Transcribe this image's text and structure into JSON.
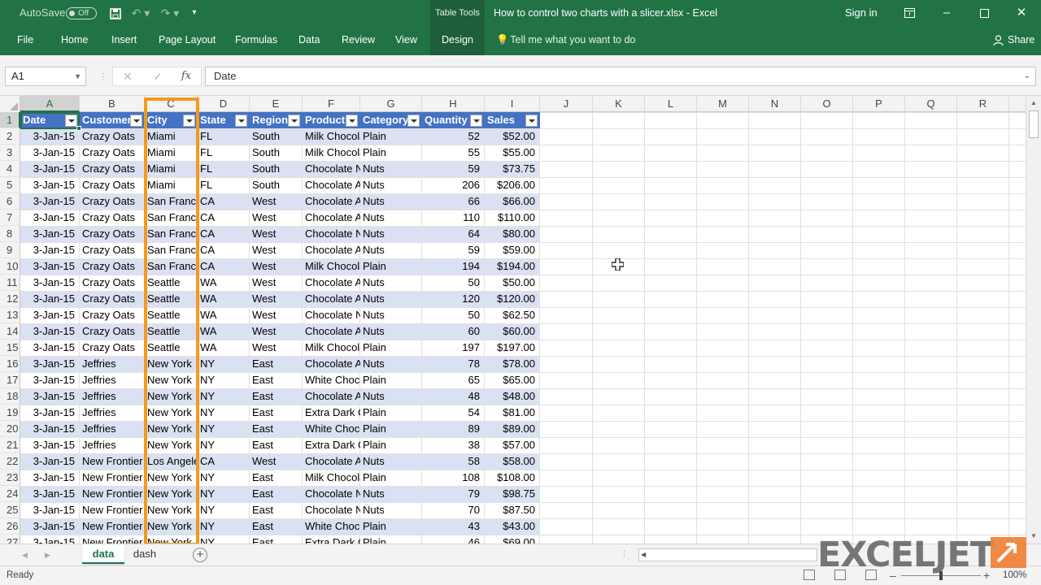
{
  "titlebar": {
    "autosave_label": "AutoSave",
    "autosave_state": "Off",
    "table_tools": "Table Tools",
    "title": "How to control two charts with a slicer.xlsx  -  Excel",
    "signin": "Sign in"
  },
  "ribbon": {
    "tabs": [
      "File",
      "Home",
      "Insert",
      "Page Layout",
      "Formulas",
      "Data",
      "Review",
      "View",
      "Design"
    ],
    "tell_me": "Tell me what you want to do",
    "share": "Share"
  },
  "formula_bar": {
    "name_box": "A1",
    "value": "Date"
  },
  "columns": [
    "A",
    "B",
    "C",
    "D",
    "E",
    "F",
    "G",
    "H",
    "I",
    "J",
    "K",
    "L",
    "M",
    "N",
    "O",
    "P",
    "Q",
    "R"
  ],
  "table": {
    "headers": [
      "Date",
      "Customer",
      "City",
      "State",
      "Region",
      "Product",
      "Category",
      "Quantity",
      "Sales"
    ],
    "rows": [
      [
        "3-Jan-15",
        "Crazy Oats",
        "Miami",
        "FL",
        "South",
        "Milk Chocolate",
        "Plain",
        "52",
        "$52.00"
      ],
      [
        "3-Jan-15",
        "Crazy Oats",
        "Miami",
        "FL",
        "South",
        "Milk Chocolate",
        "Plain",
        "55",
        "$55.00"
      ],
      [
        "3-Jan-15",
        "Crazy Oats",
        "Miami",
        "FL",
        "South",
        "Chocolate Nuts",
        "Nuts",
        "59",
        "$73.75"
      ],
      [
        "3-Jan-15",
        "Crazy Oats",
        "Miami",
        "FL",
        "South",
        "Chocolate Almonds",
        "Nuts",
        "206",
        "$206.00"
      ],
      [
        "3-Jan-15",
        "Crazy Oats",
        "San Francisco",
        "CA",
        "West",
        "Chocolate Almonds",
        "Nuts",
        "66",
        "$66.00"
      ],
      [
        "3-Jan-15",
        "Crazy Oats",
        "San Francisco",
        "CA",
        "West",
        "Chocolate Almonds",
        "Nuts",
        "110",
        "$110.00"
      ],
      [
        "3-Jan-15",
        "Crazy Oats",
        "San Francisco",
        "CA",
        "West",
        "Chocolate Nuts",
        "Nuts",
        "64",
        "$80.00"
      ],
      [
        "3-Jan-15",
        "Crazy Oats",
        "San Francisco",
        "CA",
        "West",
        "Chocolate Almonds",
        "Nuts",
        "59",
        "$59.00"
      ],
      [
        "3-Jan-15",
        "Crazy Oats",
        "San Francisco",
        "CA",
        "West",
        "Milk Chocolate",
        "Plain",
        "194",
        "$194.00"
      ],
      [
        "3-Jan-15",
        "Crazy Oats",
        "Seattle",
        "WA",
        "West",
        "Chocolate Almonds",
        "Nuts",
        "50",
        "$50.00"
      ],
      [
        "3-Jan-15",
        "Crazy Oats",
        "Seattle",
        "WA",
        "West",
        "Chocolate Almonds",
        "Nuts",
        "120",
        "$120.00"
      ],
      [
        "3-Jan-15",
        "Crazy Oats",
        "Seattle",
        "WA",
        "West",
        "Chocolate Nuts",
        "Nuts",
        "50",
        "$62.50"
      ],
      [
        "3-Jan-15",
        "Crazy Oats",
        "Seattle",
        "WA",
        "West",
        "Chocolate Almonds",
        "Nuts",
        "60",
        "$60.00"
      ],
      [
        "3-Jan-15",
        "Crazy Oats",
        "Seattle",
        "WA",
        "West",
        "Milk Chocolate",
        "Plain",
        "197",
        "$197.00"
      ],
      [
        "3-Jan-15",
        "Jeffries",
        "New York",
        "NY",
        "East",
        "Chocolate Almonds",
        "Nuts",
        "78",
        "$78.00"
      ],
      [
        "3-Jan-15",
        "Jeffries",
        "New York",
        "NY",
        "East",
        "White Chocolate",
        "Plain",
        "65",
        "$65.00"
      ],
      [
        "3-Jan-15",
        "Jeffries",
        "New York",
        "NY",
        "East",
        "Chocolate Almonds",
        "Nuts",
        "48",
        "$48.00"
      ],
      [
        "3-Jan-15",
        "Jeffries",
        "New York",
        "NY",
        "East",
        "Extra Dark Chocolate",
        "Plain",
        "54",
        "$81.00"
      ],
      [
        "3-Jan-15",
        "Jeffries",
        "New York",
        "NY",
        "East",
        "White Chocolate",
        "Plain",
        "89",
        "$89.00"
      ],
      [
        "3-Jan-15",
        "Jeffries",
        "New York",
        "NY",
        "East",
        "Extra Dark Chocolate",
        "Plain",
        "38",
        "$57.00"
      ],
      [
        "3-Jan-15",
        "New Frontier",
        "Los Angeles",
        "CA",
        "West",
        "Chocolate Almonds",
        "Nuts",
        "58",
        "$58.00"
      ],
      [
        "3-Jan-15",
        "New Frontier",
        "New York",
        "NY",
        "East",
        "Milk Chocolate",
        "Plain",
        "108",
        "$108.00"
      ],
      [
        "3-Jan-15",
        "New Frontier",
        "New York",
        "NY",
        "East",
        "Chocolate Nuts",
        "Nuts",
        "79",
        "$98.75"
      ],
      [
        "3-Jan-15",
        "New Frontier",
        "New York",
        "NY",
        "East",
        "Chocolate Nuts",
        "Nuts",
        "70",
        "$87.50"
      ],
      [
        "3-Jan-15",
        "New Frontier",
        "New York",
        "NY",
        "East",
        "White Chocolate",
        "Plain",
        "43",
        "$43.00"
      ],
      [
        "3-Jan-15",
        "New Frontier",
        "New York",
        "NY",
        "East",
        "Extra Dark Chocolate",
        "Plain",
        "46",
        "$69.00"
      ]
    ]
  },
  "sheets": [
    {
      "name": "data",
      "active": true
    },
    {
      "name": "dash",
      "active": false
    }
  ],
  "status": {
    "ready": "Ready",
    "zoom": "100%"
  },
  "watermark": {
    "text": "EXCELJET"
  },
  "colors": {
    "excel_green": "#217346",
    "table_header_blue": "#4472c4",
    "table_band": "#d9e1f2",
    "highlight_orange": "#f39a1e"
  }
}
